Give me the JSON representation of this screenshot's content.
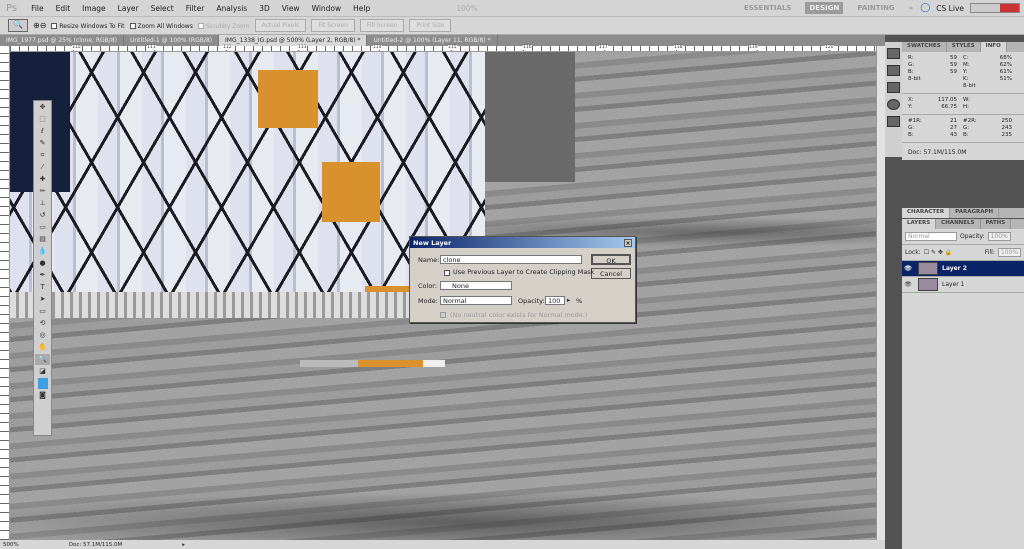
{
  "menubar": {
    "logo": "Ps",
    "items": [
      "File",
      "Edit",
      "Image",
      "Layer",
      "Select",
      "Filter",
      "Analysis",
      "3D",
      "View",
      "Window",
      "Help"
    ],
    "zoom": "100%",
    "workspaces": [
      "ESSENTIALS",
      "DESIGN",
      "PAINTING"
    ],
    "active_workspace": "DESIGN",
    "more": "»",
    "cslive": "CS Live"
  },
  "options": {
    "resize_windows": "Resize Windows To Fit",
    "zoom_all": "Zoom All Windows",
    "scrubby": "Scrubby Zoom",
    "actual_pixels": "Actual Pixels",
    "fit_screen": "Fit Screen",
    "fill_screen": "Fill Screen",
    "print_size": "Print Size"
  },
  "tabs": [
    {
      "label": "IMG_1977.psd @ 25% (clone, RGB/8)"
    },
    {
      "label": "Untitled-1 @ 100% (RGB/8)"
    },
    {
      "label": "IMG_1338_IG.psd @ 500% (Layer 2, RGB/8) *",
      "active": true
    },
    {
      "label": "Untitled-2 @ 100% (Layer 11, RGB/8) *"
    }
  ],
  "ruler": [
    "110",
    "111",
    "112",
    "113",
    "114",
    "115",
    "116",
    "117",
    "118",
    "119",
    "120"
  ],
  "status": {
    "zoom": "500%",
    "doc": "Doc: 57.1M/115.0M"
  },
  "info_panel": {
    "tabs": [
      "SWATCHES",
      "STYLES",
      "INFO"
    ],
    "active": "INFO",
    "rgb": [
      [
        "R:",
        "59"
      ],
      [
        "G:",
        "59"
      ],
      [
        "B:",
        "59"
      ]
    ],
    "rgb_bits": "8-bit",
    "cmyk": [
      [
        "C:",
        "68%"
      ],
      [
        "M:",
        "62%"
      ],
      [
        "Y:",
        "61%"
      ],
      [
        "K:",
        "51%"
      ]
    ],
    "cmyk_bits": "8-bit",
    "xy": [
      [
        "X:",
        "117.05"
      ],
      [
        "Y:",
        "66.75"
      ]
    ],
    "wh": [
      [
        "W:",
        ""
      ],
      [
        "H:",
        ""
      ]
    ],
    "s1": [
      [
        "#1R:",
        "21"
      ],
      [
        "G:",
        "27"
      ],
      [
        "B:",
        "43"
      ]
    ],
    "s2": [
      [
        "#2R:",
        "250"
      ],
      [
        "G:",
        "243"
      ],
      [
        "B:",
        "235"
      ]
    ],
    "doc": "Doc: 57.1M/115.0M"
  },
  "char_panel": {
    "tabs": [
      "CHARACTER",
      "PARAGRAPH"
    ]
  },
  "layers_panel": {
    "tabs": [
      "LAYERS",
      "CHANNELS",
      "PATHS"
    ],
    "blend": "Normal",
    "opacity_label": "Opacity:",
    "opacity": "100%",
    "lock_label": "Lock:",
    "fill_label": "Fill:",
    "fill": "100%",
    "layers": [
      {
        "name": "Layer 2",
        "selected": true
      },
      {
        "name": "Layer 1",
        "selected": false
      }
    ]
  },
  "dialog": {
    "title": "New Layer",
    "name_label": "Name:",
    "name_value": "clone",
    "clip_label": "Use Previous Layer to Create Clipping Mask",
    "color_label": "Color:",
    "color_value": "None",
    "mode_label": "Mode:",
    "mode_value": "Normal",
    "opacity_label": "Opacity:",
    "opacity_value": "100",
    "percent": "%",
    "neutral_label": "(No neutral color exists for Normal mode.)",
    "ok": "OK",
    "cancel": "Cancel"
  }
}
